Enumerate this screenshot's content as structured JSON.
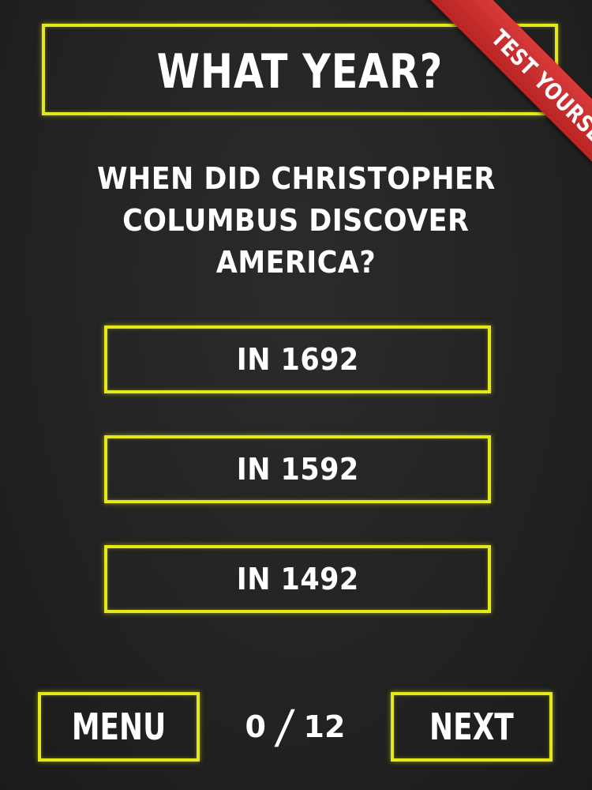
{
  "header": {
    "title": "WHAT YEAR?",
    "ribbon": "TEST YOURSELF"
  },
  "question": {
    "lines": [
      "WHEN DID CHRISTOPHER",
      "COLUMBUS DISCOVER",
      "AMERICA?"
    ]
  },
  "answers": [
    {
      "label": "IN 1692"
    },
    {
      "label": "IN 1592"
    },
    {
      "label": "IN 1492"
    }
  ],
  "footer": {
    "menu_label": "MENU",
    "next_label": "NEXT",
    "progress": {
      "current": "0",
      "separator": "/",
      "total": "12"
    }
  },
  "colors": {
    "background": "#232323",
    "neon_border": "#e4e81a",
    "ribbon": "#c92e2e",
    "text": "#ffffff"
  }
}
